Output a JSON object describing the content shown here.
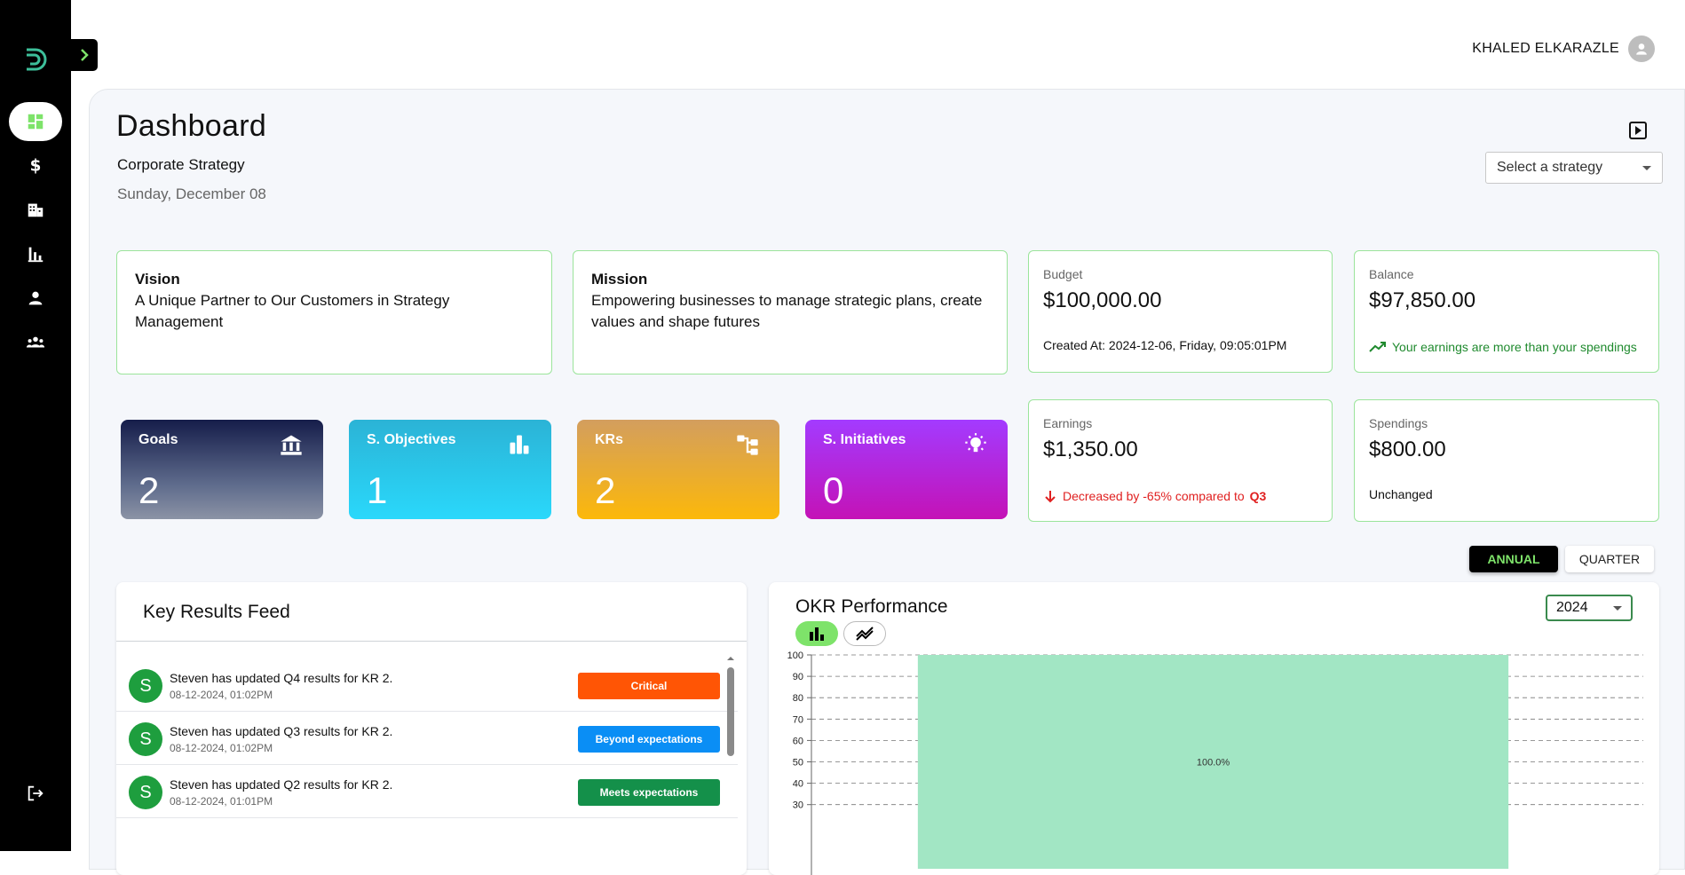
{
  "user": {
    "name": "KHALED ELKARAZLE"
  },
  "page": {
    "title": "Dashboard",
    "subtitle": "Corporate Strategy",
    "date": "Sunday, December 08"
  },
  "strategy_select": {
    "value": "Select a strategy"
  },
  "vision": {
    "title": "Vision",
    "text": "A Unique Partner to Our Customers in Strategy Management"
  },
  "mission": {
    "title": "Mission",
    "text": "Empowering businesses to manage strategic plans, create values and shape futures"
  },
  "budget": {
    "label": "Budget",
    "value": "$100,000.00",
    "note": "Created At: 2024-12-06, Friday, 09:05:01PM"
  },
  "balance": {
    "label": "Balance",
    "value": "$97,850.00",
    "note": "Your earnings are more than your spendings"
  },
  "earnings": {
    "label": "Earnings",
    "value": "$1,350.00",
    "note": "Decreased by -65% compared to",
    "note_period": "Q3"
  },
  "spendings": {
    "label": "Spendings",
    "value": "$800.00",
    "note": "Unchanged"
  },
  "kpis": [
    {
      "label": "Goals",
      "value": "2"
    },
    {
      "label": "S. Objectives",
      "value": "1"
    },
    {
      "label": "KRs",
      "value": "2"
    },
    {
      "label": "S. Initiatives",
      "value": "0"
    }
  ],
  "period": {
    "annual": "ANNUAL",
    "quarter": "QUARTER"
  },
  "feed": {
    "title": "Key Results Feed",
    "items": [
      {
        "avatar": "S",
        "text": "Steven has updated Q4 results for KR 2.",
        "time": "08-12-2024, 01:02PM",
        "badge": "Critical"
      },
      {
        "avatar": "S",
        "text": "Steven has updated Q3 results for KR 2.",
        "time": "08-12-2024, 01:02PM",
        "badge": "Beyond expectations"
      },
      {
        "avatar": "S",
        "text": "Steven has updated Q2 results for KR 2.",
        "time": "08-12-2024, 01:01PM",
        "badge": "Meets expectations"
      }
    ]
  },
  "okr": {
    "title": "OKR Performance",
    "year": "2024"
  },
  "colors": {
    "accent_green": "#7ee36a",
    "card_border": "#9be49b",
    "critical": "#ff5505",
    "beyond": "#0a8ef5",
    "meets": "#14904a",
    "bar": "#a2e6c4",
    "down": "#e02020",
    "up": "#1f8a2e"
  },
  "chart_data": {
    "type": "bar",
    "categories": [
      ""
    ],
    "values": [
      100
    ],
    "data_labels": [
      "100.0%"
    ],
    "ylim": [
      0,
      100
    ],
    "yticks": [
      30,
      40,
      50,
      60,
      70,
      80,
      90,
      100
    ],
    "grid": true
  }
}
